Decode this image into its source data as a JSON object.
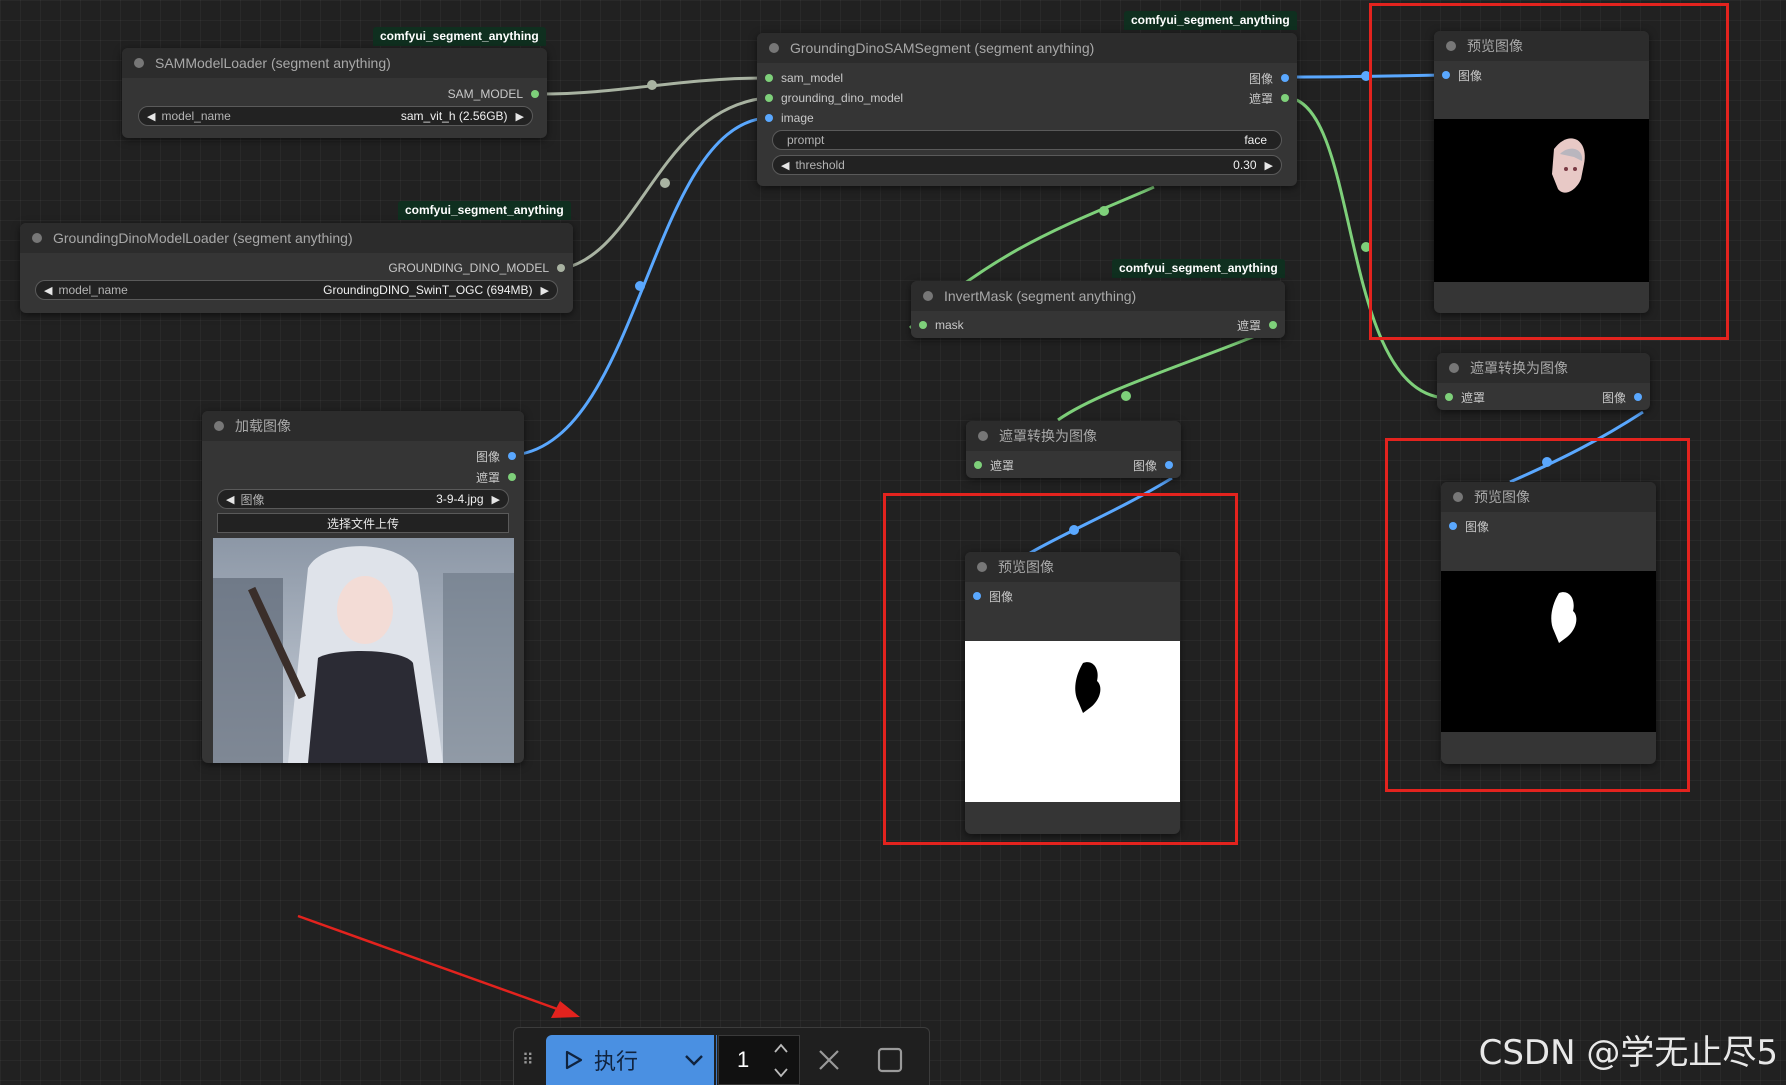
{
  "badge_text": "comfyui_segment_anything",
  "sam_loader": {
    "title": "SAMModelLoader (segment anything)",
    "output": "SAM_MODEL",
    "widget_label": "model_name",
    "widget_value": "sam_vit_h (2.56GB)"
  },
  "dino_loader": {
    "title": "GroundingDinoModelLoader (segment anything)",
    "output": "GROUNDING_DINO_MODEL",
    "widget_label": "model_name",
    "widget_value": "GroundingDINO_SwinT_OGC (694MB)"
  },
  "segment": {
    "title": "GroundingDinoSAMSegment (segment anything)",
    "inputs": [
      "sam_model",
      "grounding_dino_model",
      "image"
    ],
    "outputs": [
      "图像",
      "遮罩"
    ],
    "prompt_label": "prompt",
    "prompt_value": "face",
    "threshold_label": "threshold",
    "threshold_value": "0.30"
  },
  "invert_mask": {
    "title": "InvertMask (segment anything)",
    "input": "mask",
    "output": "遮罩"
  },
  "load_image": {
    "title": "加载图像",
    "outputs": [
      "图像",
      "遮罩"
    ],
    "widget_label": "图像",
    "widget_value": "3-9-4.jpg",
    "upload_label": "选择文件上传"
  },
  "mask_to_image_left": {
    "title": "遮罩转换为图像",
    "input": "遮罩",
    "output": "图像"
  },
  "mask_to_image_right": {
    "title": "遮罩转换为图像",
    "input": "遮罩",
    "output": "图像"
  },
  "preview_top": {
    "title": "预览图像",
    "input": "图像"
  },
  "preview_mid": {
    "title": "预览图像",
    "input": "图像"
  },
  "preview_right": {
    "title": "预览图像",
    "input": "图像"
  },
  "toolbar": {
    "run_label": "执行",
    "count": "1"
  },
  "watermark": "CSDN @学无止尽5",
  "colors": {
    "canvas": "#212121",
    "node": "#353535",
    "link_green": "#7ed07a",
    "link_blue": "#5aa8ff",
    "run_button": "#4a90e2",
    "highlight": "#e3231e"
  }
}
